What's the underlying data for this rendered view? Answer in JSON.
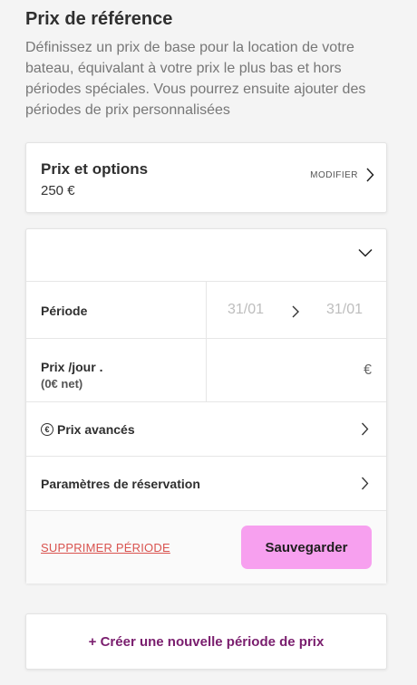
{
  "section": {
    "title": "Prix de référence",
    "description": "Définissez un prix de base pour la location de votre bateau, équivalant à votre prix le plus bas et hors périodes spéciales. Vous pourrez ensuite ajouter des périodes de prix personnalisées"
  },
  "options_card": {
    "title": "Prix et options",
    "value": "250 €",
    "modify_label": "MODIFIER"
  },
  "period_card": {
    "collapse_icon": "chevron-down-icon",
    "period_label": "Période",
    "date_start": "31/01",
    "date_end": "31/01",
    "price_label": "Prix /jour .",
    "price_net": "(0€ net)",
    "price_value": "",
    "price_unit": "€",
    "advanced_icon_glyph": "€",
    "advanced_label": "Prix avancés",
    "reservation_label": "Paramètres de réservation",
    "delete_label": "SUPPRIMER PÉRIODE",
    "save_label": "Sauvegarder"
  },
  "create_label": "+ Créer une nouvelle période de prix",
  "colors": {
    "accent_button": "#f7a0ef",
    "delete_link": "#d9534f",
    "create_link": "#7a1e6e"
  }
}
